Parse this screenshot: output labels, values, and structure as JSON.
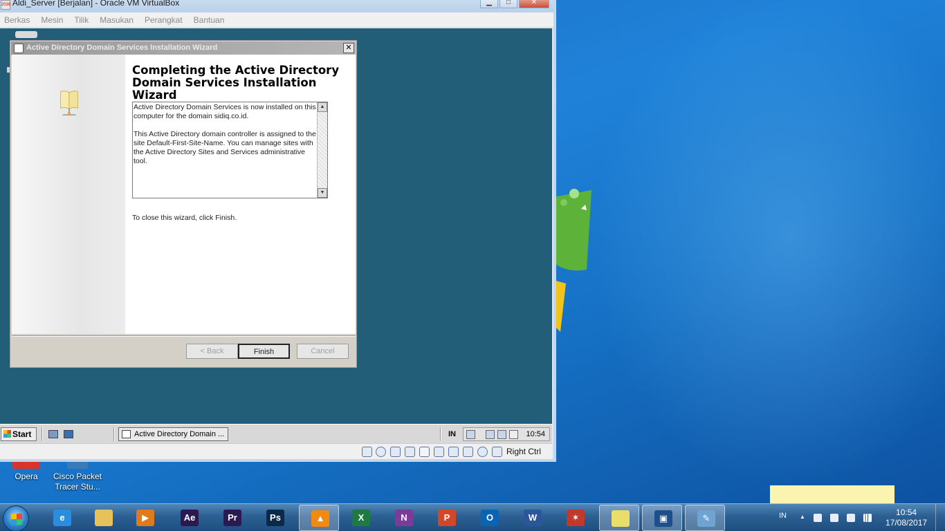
{
  "vbox": {
    "title": "Aldi_Server [Berjalan] - Oracle VM VirtualBox",
    "menu": [
      "Berkas",
      "Mesin",
      "Tilik",
      "Masukan",
      "Perangkat",
      "Bantuan"
    ],
    "controls": [
      "minimize-icon",
      "maximize-icon",
      "close-icon"
    ],
    "status_host_key": "Right Ctrl"
  },
  "wizard": {
    "title": "Active Directory Domain Services Installation Wizard",
    "heading": "Completing the Active Directory Domain Services Installation Wizard",
    "paragraph1": "Active Directory Domain Services is now installed on this computer for the domain sidiq.co.id.",
    "paragraph2": "This Active Directory domain controller is assigned to the site Default-First-Site-Name. You can manage sites with the Active Directory Sites and Services administrative tool.",
    "close_hint": "To close this wizard, click Finish.",
    "back_label": "< Back",
    "finish_label": "Finish",
    "cancel_label": "Cancel"
  },
  "guest_taskbar": {
    "start_label": "Start",
    "task_item_label": "Active Directory Domain ...",
    "language": "IN",
    "clock": "10:54"
  },
  "host_desktop": {
    "icons": [
      {
        "label": "Opera",
        "icon": "opera-icon",
        "color": "#d9342b"
      },
      {
        "label": "Cisco Packet Tracer Stu...",
        "icon": "cisco-packet-tracer-icon",
        "color": "#3a7ab8"
      }
    ]
  },
  "host_taskbar": {
    "apps": [
      {
        "name": "ie-icon",
        "glyph": "e",
        "color": "#2a8ee0",
        "active": false
      },
      {
        "name": "file-explorer-icon",
        "glyph": "",
        "color": "#e7c25a",
        "active": false
      },
      {
        "name": "media-player-icon",
        "glyph": "▶",
        "color": "#e07a1e",
        "active": false
      },
      {
        "name": "after-effects-icon",
        "glyph": "Ae",
        "color": "#2b1a52",
        "active": false
      },
      {
        "name": "premiere-icon",
        "glyph": "Pr",
        "color": "#2b1a52",
        "active": false
      },
      {
        "name": "photoshop-icon",
        "glyph": "Ps",
        "color": "#0b2a4a",
        "active": false
      },
      {
        "name": "vlc-icon",
        "glyph": "▲",
        "color": "#f08a12",
        "active": true
      },
      {
        "name": "excel-icon",
        "glyph": "X",
        "color": "#1f7a3f",
        "active": false
      },
      {
        "name": "onenote-icon",
        "glyph": "N",
        "color": "#7c3b99",
        "active": false
      },
      {
        "name": "powerpoint-icon",
        "glyph": "P",
        "color": "#d24726",
        "active": false
      },
      {
        "name": "outlook-icon",
        "glyph": "O",
        "color": "#0a64b4",
        "active": false
      },
      {
        "name": "word-icon",
        "glyph": "W",
        "color": "#2b579a",
        "active": false
      },
      {
        "name": "packet-tracer-icon",
        "glyph": "✶",
        "color": "#c0392b",
        "active": false
      },
      {
        "name": "sticky-notes-icon",
        "glyph": "",
        "color": "#e8df6a",
        "active": true
      },
      {
        "name": "virtualbox-icon",
        "glyph": "▣",
        "color": "#1d4f8a",
        "active": true
      },
      {
        "name": "paint-icon",
        "glyph": "✎",
        "color": "#6fa3d2",
        "active": true
      }
    ],
    "language": "IN",
    "time": "10:54",
    "date": "17/08/2017"
  }
}
